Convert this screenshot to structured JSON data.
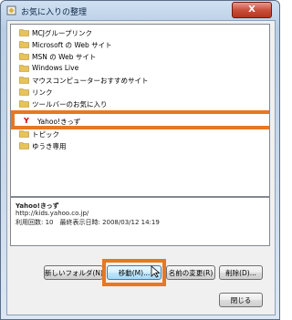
{
  "window": {
    "title": "お気に入りの整理",
    "close_label": "X"
  },
  "folders": [
    {
      "label": "MCJグループリンク"
    },
    {
      "label": "Microsoft の Web サイト"
    },
    {
      "label": "MSN の Web サイト"
    },
    {
      "label": "Windows Live"
    },
    {
      "label": "マウスコンピューターおすすめサイト"
    },
    {
      "label": "リンク"
    },
    {
      "label": "ツールバーのお気に入り"
    }
  ],
  "selected_item": {
    "label": "Yahoo!きっず",
    "icon": "yahoo-icon"
  },
  "folders_after": [
    {
      "label": "トピック"
    },
    {
      "label": "ゆうき専用"
    }
  ],
  "info": {
    "name": "Yahoo!きっず",
    "url": "http://kids.yahoo.co.jp/",
    "stats": "利用回数: 10　最終表示日時: 2008/03/12 14:19"
  },
  "buttons": {
    "new_folder": "新しいフォルダ(N)",
    "move": "移動(M)...",
    "rename": "名前の変更(R)",
    "delete": "削除(D)...",
    "close": "閉じる"
  },
  "colors": {
    "highlight": "#e87722",
    "folder": "#e8c25a"
  }
}
